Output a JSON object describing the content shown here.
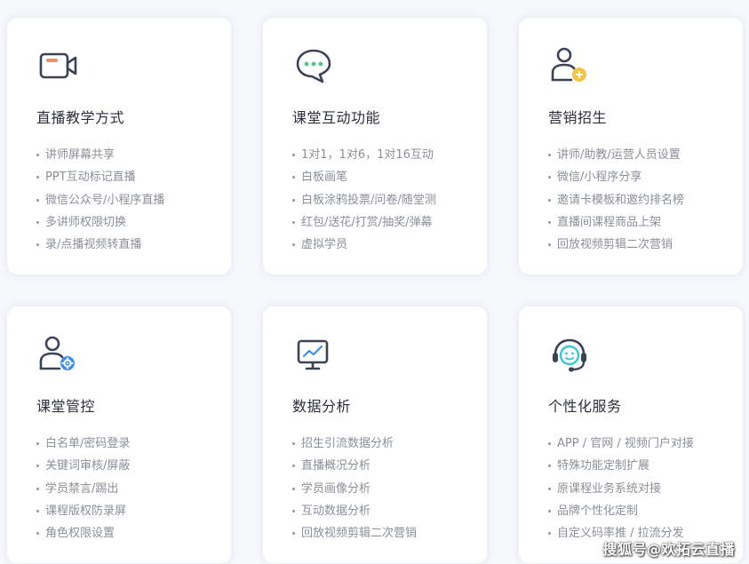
{
  "cards": [
    {
      "icon": "video-camera-icon",
      "title": "直播教学方式",
      "items": [
        "讲师屏幕共享",
        "PPT互动标记直播",
        "微信公众号/小程序直播",
        "多讲师权限切换",
        "录/点播视频转直播"
      ]
    },
    {
      "icon": "chat-bubble-icon",
      "title": "课堂互动功能",
      "items": [
        "1对1，1对6，1对16互动",
        "白板画笔",
        "白板涂鸦投票/问卷/随堂测",
        "红包/送花/打赏/抽奖/弹幕",
        "虚拟学员"
      ]
    },
    {
      "icon": "user-add-icon",
      "title": "营销招生",
      "items": [
        "讲师/助教/运营人员设置",
        "微信/小程序分享",
        "邀请卡模板和邀约排名榜",
        "直播间课程商品上架",
        "回放视频剪辑二次营销"
      ]
    },
    {
      "icon": "user-settings-icon",
      "title": "课堂管控",
      "items": [
        "白名单/密码登录",
        "关键词审核/屏蔽",
        "学员禁言/踢出",
        "课程版权防录屏",
        "角色权限设置"
      ]
    },
    {
      "icon": "chart-monitor-icon",
      "title": "数据分析",
      "items": [
        "招生引流数据分析",
        "直播概况分析",
        "学员画像分析",
        "互动数据分析",
        "回放视频剪辑二次营销"
      ]
    },
    {
      "icon": "headset-support-icon",
      "title": "个性化服务",
      "items": [
        "APP / 官网 / 视频门户对接",
        "特殊功能定制扩展",
        "原课程业务系统对接",
        "品牌个性化定制",
        "自定义码率推 / 拉流分发"
      ]
    }
  ],
  "watermark": "搜狐号@欢拓云直播",
  "colors": {
    "icon_dark": "#3c4356",
    "accent_orange": "#f28c5a",
    "accent_green": "#4cc98a",
    "accent_yellow": "#f6c344",
    "accent_blue": "#3d8ef0",
    "accent_cyan": "#35c6d8"
  }
}
